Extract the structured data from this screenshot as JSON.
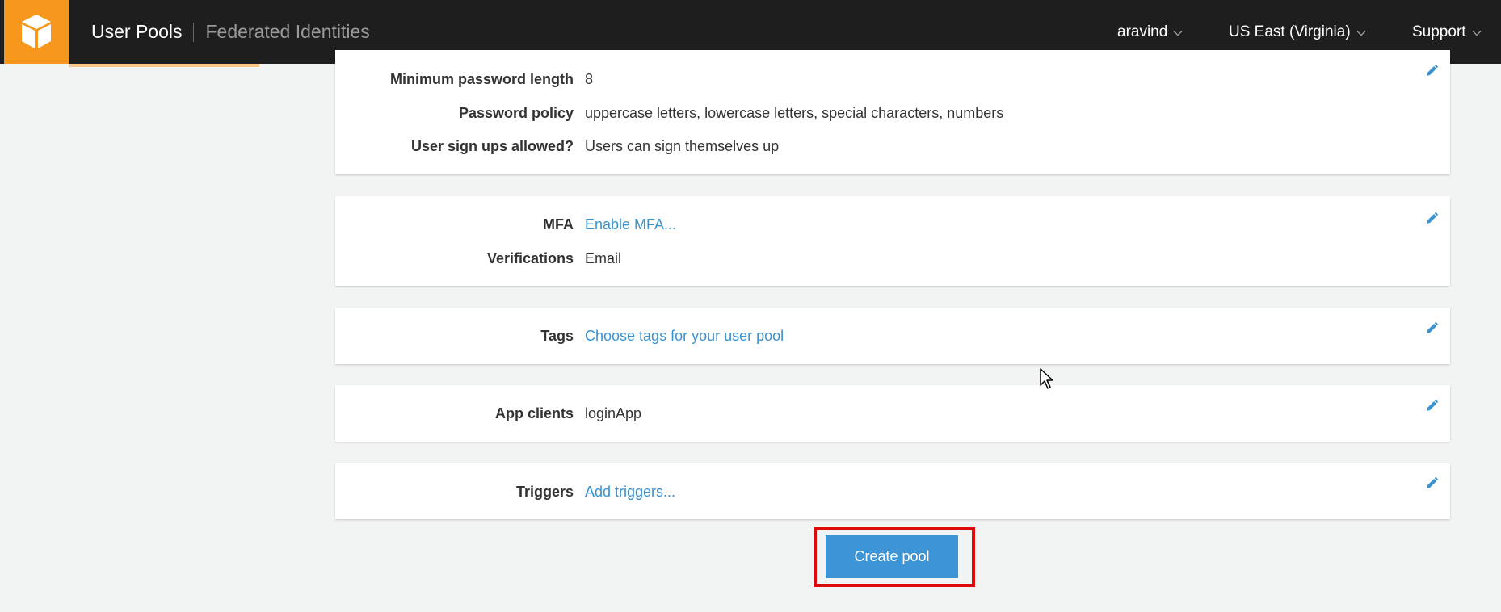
{
  "header": {
    "logo_icon": "cognito-cube-icon",
    "tabs": [
      {
        "label": "User Pools",
        "active": true
      },
      {
        "label": "Federated Identities",
        "active": false
      }
    ],
    "user_menu": "aravind",
    "region_menu": "US East (Virginia)",
    "support_menu": "Support",
    "colors": {
      "bar": "#1e1e1e",
      "logo_bg": "#f7981d"
    }
  },
  "cards": {
    "policies": {
      "rows": [
        {
          "label": "Minimum password length",
          "value": "8"
        },
        {
          "label": "Password policy",
          "value": "uppercase letters, lowercase letters, special characters, numbers"
        },
        {
          "label": "User sign ups allowed?",
          "value": "Users can sign themselves up"
        }
      ]
    },
    "mfa": {
      "rows": [
        {
          "label": "MFA",
          "value": "Enable MFA..."
        },
        {
          "label": "Verifications",
          "value": "Email"
        }
      ]
    },
    "tags": {
      "rows": [
        {
          "label": "Tags",
          "value": "Choose tags for your user pool"
        }
      ]
    },
    "app_clients": {
      "rows": [
        {
          "label": "App clients",
          "value": "loginApp"
        }
      ]
    },
    "triggers": {
      "rows": [
        {
          "label": "Triggers",
          "value": "Add triggers..."
        }
      ]
    }
  },
  "actions": {
    "create_label": "Create pool",
    "button_color": "#3d95d6",
    "highlight_color": "#dd0b0b"
  },
  "icons": {
    "edit": "pencil-icon",
    "dropdown": "chevron-down-icon",
    "cursor": "mouse-pointer-icon"
  },
  "link_color": "#3a92cf"
}
